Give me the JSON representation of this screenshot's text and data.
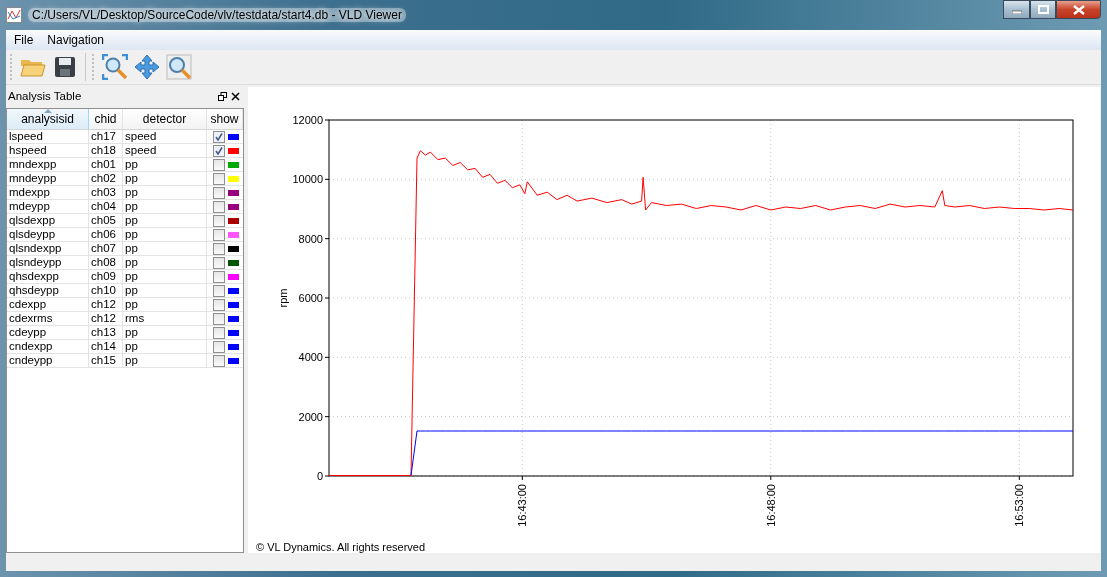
{
  "window": {
    "title": "C:/Users/VL/Desktop/SourceCode/vlv/testdata/start4.db - VLD Viewer"
  },
  "menu": [
    {
      "label": "File"
    },
    {
      "label": "Navigation"
    }
  ],
  "dock": {
    "title": "Analysis Table",
    "columns": [
      {
        "label": "analysisid",
        "sorted": true
      },
      {
        "label": "chid",
        "sorted": false
      },
      {
        "label": "detector",
        "sorted": false
      },
      {
        "label": "show",
        "sorted": false
      }
    ],
    "rows": [
      {
        "analysisid": "lspeed",
        "chid": "ch17",
        "detector": "speed",
        "show": true,
        "color": "#0000ff"
      },
      {
        "analysisid": "hspeed",
        "chid": "ch18",
        "detector": "speed",
        "show": true,
        "color": "#ff0000"
      },
      {
        "analysisid": "mndexpp",
        "chid": "ch01",
        "detector": "pp",
        "show": false,
        "color": "#00aa00"
      },
      {
        "analysisid": "mndeypp",
        "chid": "ch02",
        "detector": "pp",
        "show": false,
        "color": "#ffff00"
      },
      {
        "analysisid": "mdexpp",
        "chid": "ch03",
        "detector": "pp",
        "show": false,
        "color": "#990080"
      },
      {
        "analysisid": "mdeypp",
        "chid": "ch04",
        "detector": "pp",
        "show": false,
        "color": "#990080"
      },
      {
        "analysisid": "qlsdexpp",
        "chid": "ch05",
        "detector": "pp",
        "show": false,
        "color": "#aa0000"
      },
      {
        "analysisid": "qlsdeypp",
        "chid": "ch06",
        "detector": "pp",
        "show": false,
        "color": "#ff55ff"
      },
      {
        "analysisid": "qlsndexpp",
        "chid": "ch07",
        "detector": "pp",
        "show": false,
        "color": "#000000"
      },
      {
        "analysisid": "qlsndeypp",
        "chid": "ch08",
        "detector": "pp",
        "show": false,
        "color": "#005500"
      },
      {
        "analysisid": "qhsdexpp",
        "chid": "ch09",
        "detector": "pp",
        "show": false,
        "color": "#ff00ff"
      },
      {
        "analysisid": "qhsdeypp",
        "chid": "ch10",
        "detector": "pp",
        "show": false,
        "color": "#0000ff"
      },
      {
        "analysisid": "cdexpp",
        "chid": "ch12",
        "detector": "pp",
        "show": false,
        "color": "#0000ff"
      },
      {
        "analysisid": "cdexrms",
        "chid": "ch12",
        "detector": "rms",
        "show": false,
        "color": "#0000ff"
      },
      {
        "analysisid": "cdeypp",
        "chid": "ch13",
        "detector": "pp",
        "show": false,
        "color": "#0000ff"
      },
      {
        "analysisid": "cndexpp",
        "chid": "ch14",
        "detector": "pp",
        "show": false,
        "color": "#0000ff"
      },
      {
        "analysisid": "cndeypp",
        "chid": "ch15",
        "detector": "pp",
        "show": false,
        "color": "#0000ff"
      }
    ]
  },
  "chart": {
    "chart_data": {
      "type": "line",
      "ylabel": "rpm",
      "grid": true,
      "x": [
        59946.6,
        60044.4,
        60045.6,
        60052.8,
        60057,
        60063,
        60069,
        60078,
        60087,
        60096,
        60105,
        60114,
        60123,
        60132,
        60141,
        60150,
        60159,
        60168,
        60177,
        60183,
        60186,
        60198,
        60210,
        60222,
        60234,
        60246,
        60264,
        60282,
        60300,
        60312,
        60324,
        60325.8,
        60328.8,
        60336,
        60354,
        60372,
        60390,
        60408,
        60426,
        60444,
        60462,
        60480,
        60498,
        60516,
        60534,
        60552,
        60570,
        60588,
        60606,
        60624,
        60642,
        60660,
        60678,
        60687,
        60690,
        60702,
        60720,
        60738,
        60756,
        60774,
        60792,
        60810,
        60828,
        60844.8
      ],
      "series": [
        {
          "color": "#ff0000",
          "values": [
            0,
            0,
            0,
            10700,
            10950,
            10800,
            10900,
            10650,
            10700,
            10450,
            10550,
            10300,
            10350,
            10050,
            10150,
            9850,
            9950,
            9700,
            9800,
            9500,
            9900,
            9450,
            9550,
            9300,
            9450,
            9250,
            9350,
            9200,
            9300,
            9150,
            9250,
            10050,
            8950,
            9200,
            9100,
            9150,
            9000,
            9100,
            9050,
            8950,
            9100,
            8950,
            9050,
            9000,
            9100,
            8950,
            9050,
            9100,
            9000,
            9150,
            9050,
            9100,
            9050,
            9600,
            9100,
            9050,
            9100,
            9000,
            9050,
            9000,
            9000,
            8950,
            9000,
            8950
          ]
        },
        {
          "color": "#0000ff",
          "values": [
            null,
            null,
            0,
            1500,
            1500,
            1500,
            1500,
            1500,
            1500,
            1500,
            1500,
            1500,
            1500,
            1500,
            1500,
            1500,
            1500,
            1500,
            1500,
            1500,
            1500,
            1500,
            1500,
            1500,
            1500,
            1500,
            1500,
            1500,
            1500,
            1500,
            1500,
            1500,
            1500,
            1500,
            1500,
            1500,
            1500,
            1500,
            1500,
            1500,
            1500,
            1500,
            1500,
            1500,
            1500,
            1500,
            1500,
            1500,
            1500,
            1500,
            1500,
            1500,
            1500,
            1500,
            1500,
            1500,
            1500,
            1500,
            1500,
            1500,
            1500,
            1500,
            1500,
            1500
          ]
        }
      ],
      "xlim": [
        59946.6,
        60844.8
      ],
      "ylim": [
        0,
        12000
      ],
      "xticks": [
        {
          "value": 60180,
          "label": "16:43:00"
        },
        {
          "value": 60480,
          "label": "16:48:00"
        },
        {
          "value": 60780,
          "label": "16:53:00"
        }
      ],
      "yticks": [
        0,
        2000,
        4000,
        6000,
        8000,
        10000,
        12000
      ]
    },
    "footer": "© VL Dynamics. All rights reserved"
  }
}
